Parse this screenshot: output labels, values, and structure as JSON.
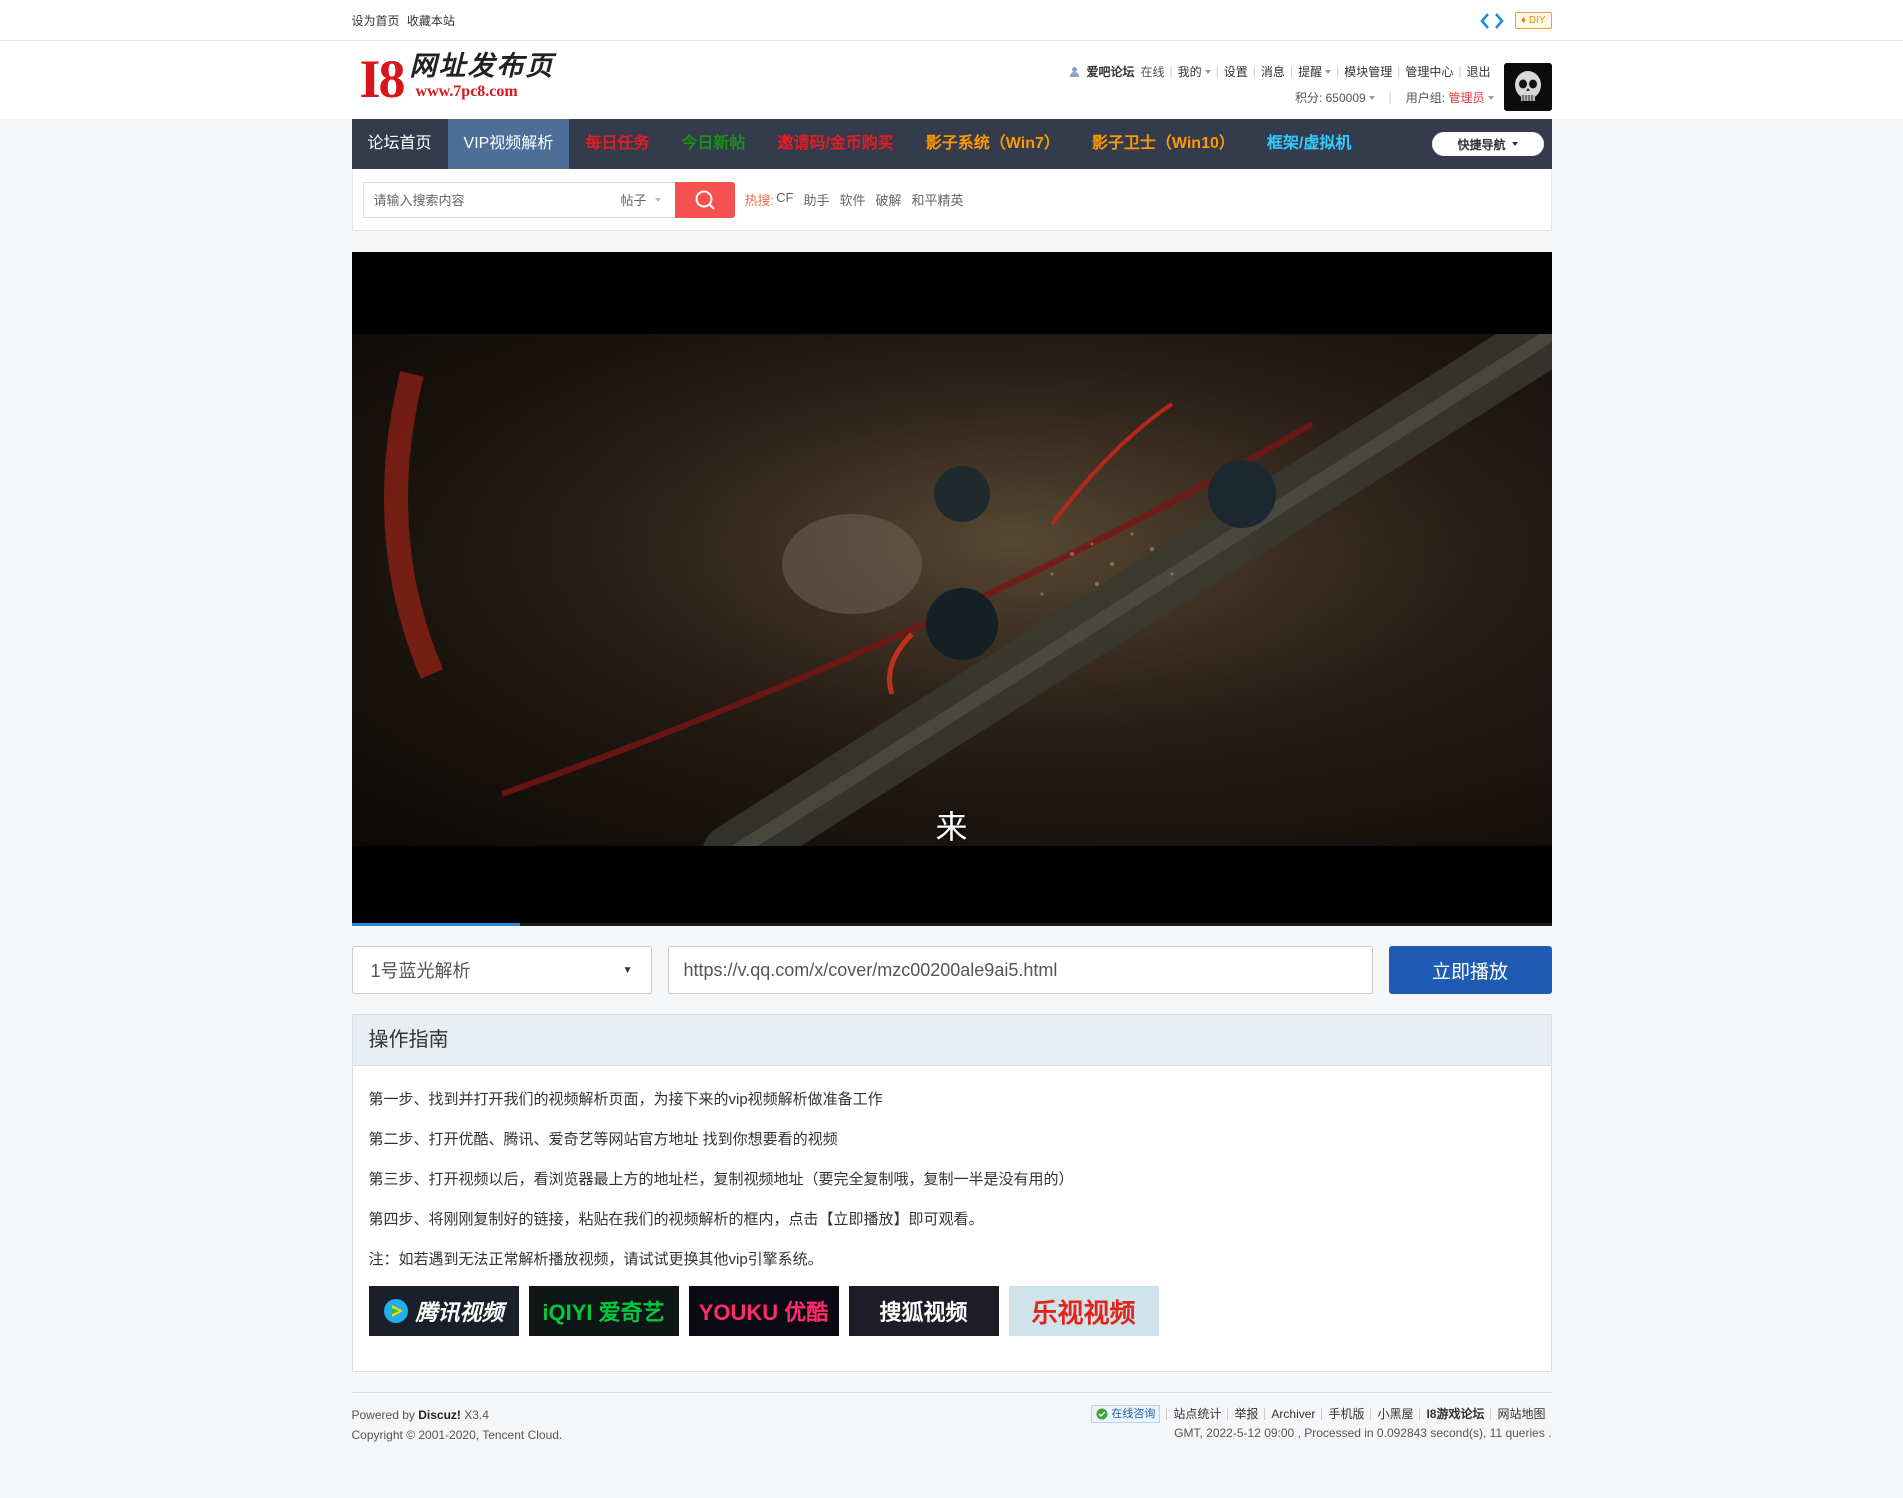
{
  "toolbar": {
    "set_home": "设为首页",
    "bookmark": "收藏本站",
    "diy": "DIY"
  },
  "header": {
    "logo_i8": "I8",
    "logo_cn": "网址发布页",
    "logo_url": "www.7pc8.com",
    "user": "爱吧论坛",
    "online": "在线",
    "menu": [
      "我的",
      "设置",
      "消息",
      "提醒",
      "模块管理",
      "管理中心",
      "退出"
    ],
    "points_label": "积分: 650009",
    "group_label": "用户组:",
    "group_value": "管理员"
  },
  "nav": {
    "items": [
      {
        "label": "论坛首页",
        "color": "#ffffff"
      },
      {
        "label": "VIP视频解析",
        "color": "#ffffff"
      },
      {
        "label": "每日任务",
        "color": "#e51c23"
      },
      {
        "label": "今日新帖",
        "color": "#1a8f1a"
      },
      {
        "label": "邀请码/金币购买",
        "color": "#e51c23"
      },
      {
        "label": "影子系统（Win7）",
        "color": "#ff9900"
      },
      {
        "label": "影子卫士（Win10）",
        "color": "#ff9900"
      },
      {
        "label": "框架/虚拟机",
        "color": "#33ccff"
      }
    ],
    "quick": "快捷导航"
  },
  "search": {
    "placeholder": "请输入搜索内容",
    "type": "帖子",
    "hot_label": "热搜:",
    "hot": [
      "CF",
      "助手",
      "软件",
      "破解",
      "和平精英"
    ]
  },
  "video": {
    "subtitle": "来",
    "progress": 0.14
  },
  "controls": {
    "parser": "1号蓝光解析",
    "url": "https://v.qq.com/x/cover/mzc00200ale9ai5.html",
    "play": "立即播放"
  },
  "guide": {
    "title": "操作指南",
    "steps": [
      "第一步、找到并打开我们的视频解析页面，为接下来的vip视频解析做准备工作",
      "第二步、打开优酷、腾讯、爱奇艺等网站官方地址 找到你想要看的视频",
      "第三步、打开视频以后，看浏览器最上方的地址栏，复制视频地址（要完全复制哦，复制一半是没有用的）",
      "第四步、将刚刚复制好的链接，粘贴在我们的视频解析的框内，点击【立即播放】即可观看。",
      "注：如若遇到无法正常解析播放视频，请试试更换其他vip引擎系统。"
    ],
    "platforms": [
      "腾讯视频",
      "iQIYI 爱奇艺",
      "YOUKU 优酷",
      "搜狐视频",
      "乐视视频"
    ]
  },
  "footer": {
    "powered_prefix": "Powered by",
    "powered_brand": "Discuz!",
    "powered_ver": "X3.4",
    "copyright": "Copyright © 2001-2020, Tencent Cloud.",
    "consult": "在线咨询",
    "links": [
      "站点统计",
      "举报",
      "Archiver",
      "手机版",
      "小黑屋",
      "I8游戏论坛",
      "网站地图"
    ],
    "stats": "GMT, 2022-5-12 09:00 , Processed in 0.092843 second(s), 11 queries ."
  }
}
